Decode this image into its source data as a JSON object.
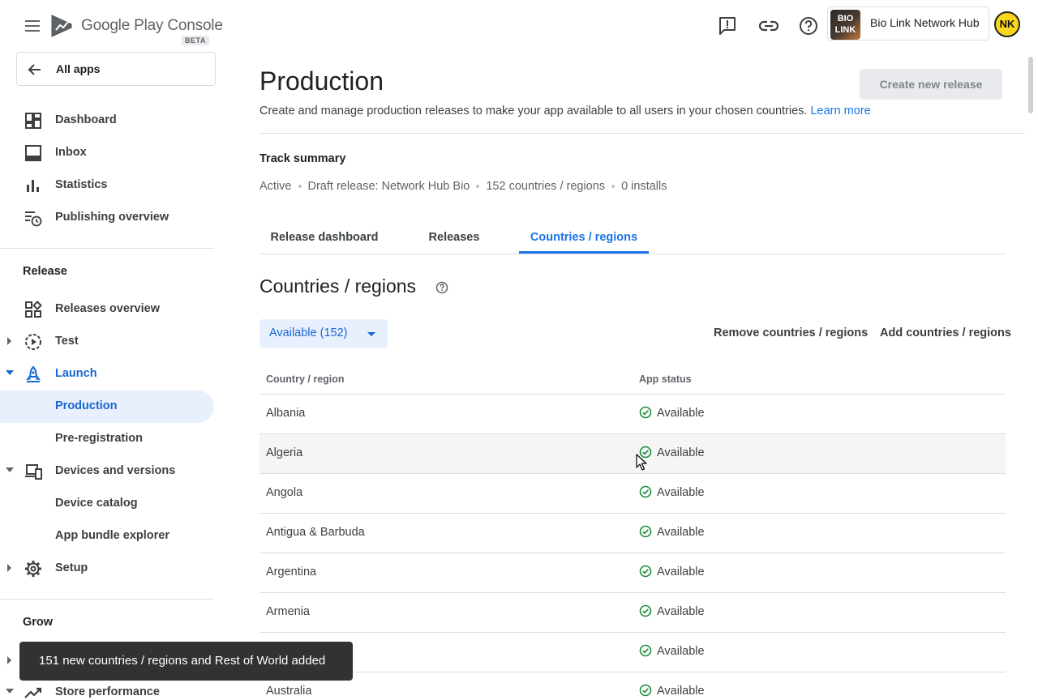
{
  "header": {
    "logo_text": "Google Play Console",
    "logo_badge": "BETA",
    "app_thumb_text": "BIO LINK",
    "app_name": "Bio Link Network Hub",
    "avatar_initials": "NK",
    "icons": [
      "menu-icon",
      "feedback-icon",
      "link-icon",
      "help-icon"
    ]
  },
  "sidebar": {
    "all_apps": "All apps",
    "top_items": [
      {
        "label": "Dashboard",
        "icon": "dashboard-icon"
      },
      {
        "label": "Inbox",
        "icon": "inbox-icon"
      },
      {
        "label": "Statistics",
        "icon": "statistics-icon"
      },
      {
        "label": "Publishing overview",
        "icon": "publishing-overview-icon"
      }
    ],
    "release_title": "Release",
    "release_items": [
      {
        "label": "Releases overview",
        "icon": "releases-overview-icon"
      },
      {
        "label": "Test",
        "icon": "test-icon"
      },
      {
        "label": "Launch",
        "icon": "launch-icon"
      },
      {
        "label": "Production"
      },
      {
        "label": "Pre-registration"
      },
      {
        "label": "Devices and versions",
        "icon": "devices-icon"
      },
      {
        "label": "Device catalog"
      },
      {
        "label": "App bundle explorer"
      },
      {
        "label": "Setup",
        "icon": "settings-icon"
      }
    ],
    "grow_title": "Grow",
    "grow_items": [
      {
        "label": "Store performance",
        "icon": "store-performance-icon"
      }
    ]
  },
  "main": {
    "title": "Production",
    "description": "Create and manage production releases to make your app available to all users in your chosen countries.",
    "learn_more": "Learn more",
    "create_button": "Create new release",
    "track_summary_title": "Track summary",
    "track_summary": [
      "Active",
      "Draft release: Network Hub Bio",
      "152 countries / regions",
      "0 installs"
    ],
    "tabs": [
      "Release dashboard",
      "Releases",
      "Countries / regions"
    ],
    "active_tab": "Countries / regions",
    "section_title": "Countries / regions",
    "filter_label": "Available (152)",
    "remove_button": "Remove countries / regions",
    "add_button": "Add countries / regions",
    "table": {
      "headers": [
        "Country / region",
        "App status"
      ],
      "rows": [
        {
          "country": "Albania",
          "status": "Available"
        },
        {
          "country": "Algeria",
          "status": "Available"
        },
        {
          "country": "Angola",
          "status": "Available"
        },
        {
          "country": "Antigua & Barbuda",
          "status": "Available"
        },
        {
          "country": "Argentina",
          "status": "Available"
        },
        {
          "country": "Armenia",
          "status": "Available"
        },
        {
          "country": "",
          "status": "Available"
        },
        {
          "country": "Australia",
          "status": "Available"
        }
      ]
    }
  },
  "snackbar": "151 new countries / regions and Rest of World added",
  "colors": {
    "accent": "#1a73e8",
    "active_nav_bg": "#e8f0fe",
    "status_ok": "#1e8e3e",
    "snackbar_bg": "#323232"
  }
}
